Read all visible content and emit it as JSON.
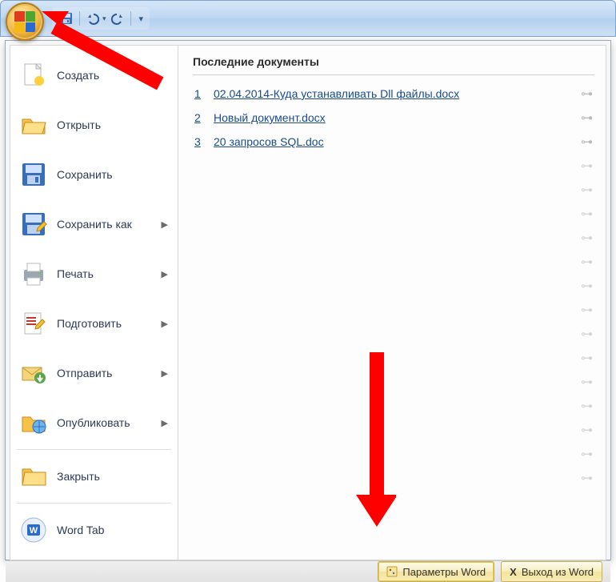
{
  "qat": {
    "save_icon": "save-icon",
    "undo_icon": "undo-icon",
    "redo_icon": "redo-icon",
    "customize_icon": "dropdown-icon"
  },
  "menu": {
    "items": [
      {
        "key": "new",
        "label": "Создать",
        "icon": "new-doc-icon",
        "has_arrow": false
      },
      {
        "key": "open",
        "label": "Открыть",
        "icon": "open-folder-icon",
        "has_arrow": false
      },
      {
        "key": "save",
        "label": "Сохранить",
        "icon": "save-disk-icon",
        "has_arrow": false
      },
      {
        "key": "saveas",
        "label": "Сохранить как",
        "icon": "save-as-icon",
        "has_arrow": true
      },
      {
        "key": "print",
        "label": "Печать",
        "icon": "printer-icon",
        "has_arrow": true
      },
      {
        "key": "prepare",
        "label": "Подготовить",
        "icon": "prepare-icon",
        "has_arrow": true
      },
      {
        "key": "send",
        "label": "Отправить",
        "icon": "send-icon",
        "has_arrow": true
      },
      {
        "key": "publish",
        "label": "Опубликовать",
        "icon": "publish-icon",
        "has_arrow": true
      },
      {
        "key": "close",
        "label": "Закрыть",
        "icon": "close-folder-icon",
        "has_arrow": false
      },
      {
        "key": "wordtab",
        "label": "Word Tab",
        "icon": "word-tab-icon",
        "has_arrow": false
      }
    ]
  },
  "recent": {
    "title": "Последние документы",
    "items": [
      {
        "num": "1",
        "name": "02.04.2014-Куда устанавливать Dll файлы.docx"
      },
      {
        "num": "2",
        "name": "Новый документ.docx"
      },
      {
        "num": "3",
        "name": "20 запросов SQL.doc"
      }
    ],
    "ghost_pin_count": 14
  },
  "footer": {
    "options_label": "Параметры Word",
    "exit_label": "Выход из Word"
  }
}
